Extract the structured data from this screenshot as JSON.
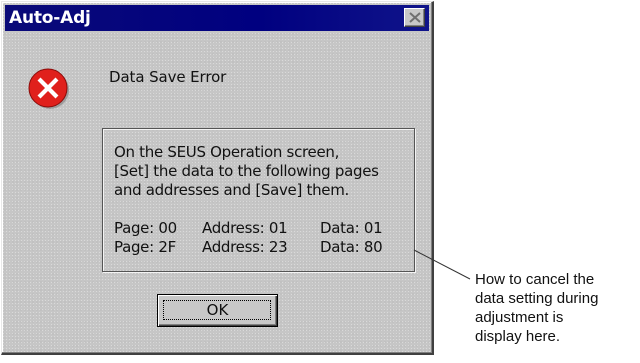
{
  "dialog": {
    "title": "Auto-Adj",
    "close_icon": "close-x-icon",
    "icon": "error-icon",
    "message_title": "Data Save Error",
    "instructions": [
      "On the SEUS Operation screen,",
      "[Set] the data to the following pages",
      "and addresses and [Save] them."
    ],
    "entries": [
      {
        "page": "Page: 00",
        "address": "Address: 01",
        "data": "Data: 01"
      },
      {
        "page": "Page: 2F",
        "address": "Address: 23",
        "data": "Data: 80"
      }
    ],
    "ok_label": "OK"
  },
  "annotation": {
    "lines": [
      "How to cancel the",
      "data setting during",
      "adjustment is",
      "display here."
    ]
  },
  "colors": {
    "titlebar": "#000080",
    "dialog_bg": "#c6c6c6",
    "error_red": "#e0201c"
  }
}
